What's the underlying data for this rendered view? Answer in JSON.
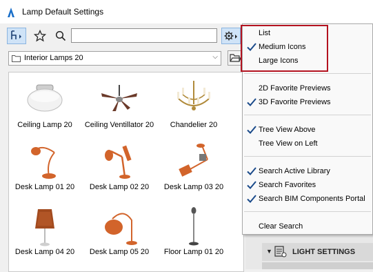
{
  "window": {
    "title": "Lamp Default Settings"
  },
  "toolbar": {
    "search_value": "",
    "search_placeholder": ""
  },
  "folder": {
    "label": "Interior Lamps 20"
  },
  "grid": {
    "items": [
      {
        "label": "Ceiling Lamp 20"
      },
      {
        "label": "Ceiling Ventillator 20"
      },
      {
        "label": "Chandelier 20"
      },
      {
        "label": "Desk Lamp 01 20"
      },
      {
        "label": "Desk Lamp 02 20"
      },
      {
        "label": "Desk Lamp 03 20"
      },
      {
        "label": "Desk Lamp 04 20"
      },
      {
        "label": "Desk Lamp 05 20"
      },
      {
        "label": "Floor Lamp 01 20"
      }
    ]
  },
  "menu": {
    "items": [
      {
        "label": "List",
        "checked": false
      },
      {
        "label": "Medium Icons",
        "checked": true
      },
      {
        "label": "Large Icons",
        "checked": false
      },
      {
        "label": "2D Favorite Previews",
        "checked": false
      },
      {
        "label": "3D Favorite Previews",
        "checked": true
      },
      {
        "label": "Tree View Above",
        "checked": true
      },
      {
        "label": "Tree View on Left",
        "checked": false
      },
      {
        "label": "Search Active Library",
        "checked": true
      },
      {
        "label": "Search Favorites",
        "checked": true
      },
      {
        "label": "Search BIM Components Portal",
        "checked": true
      },
      {
        "label": "Clear Search",
        "checked": false
      }
    ]
  },
  "panel": {
    "light_settings_label": "LIGHT SETTINGS"
  },
  "colors": {
    "accent": "#1a6fc9",
    "highlight": "#b3121f",
    "lamp": "#d2642b"
  }
}
